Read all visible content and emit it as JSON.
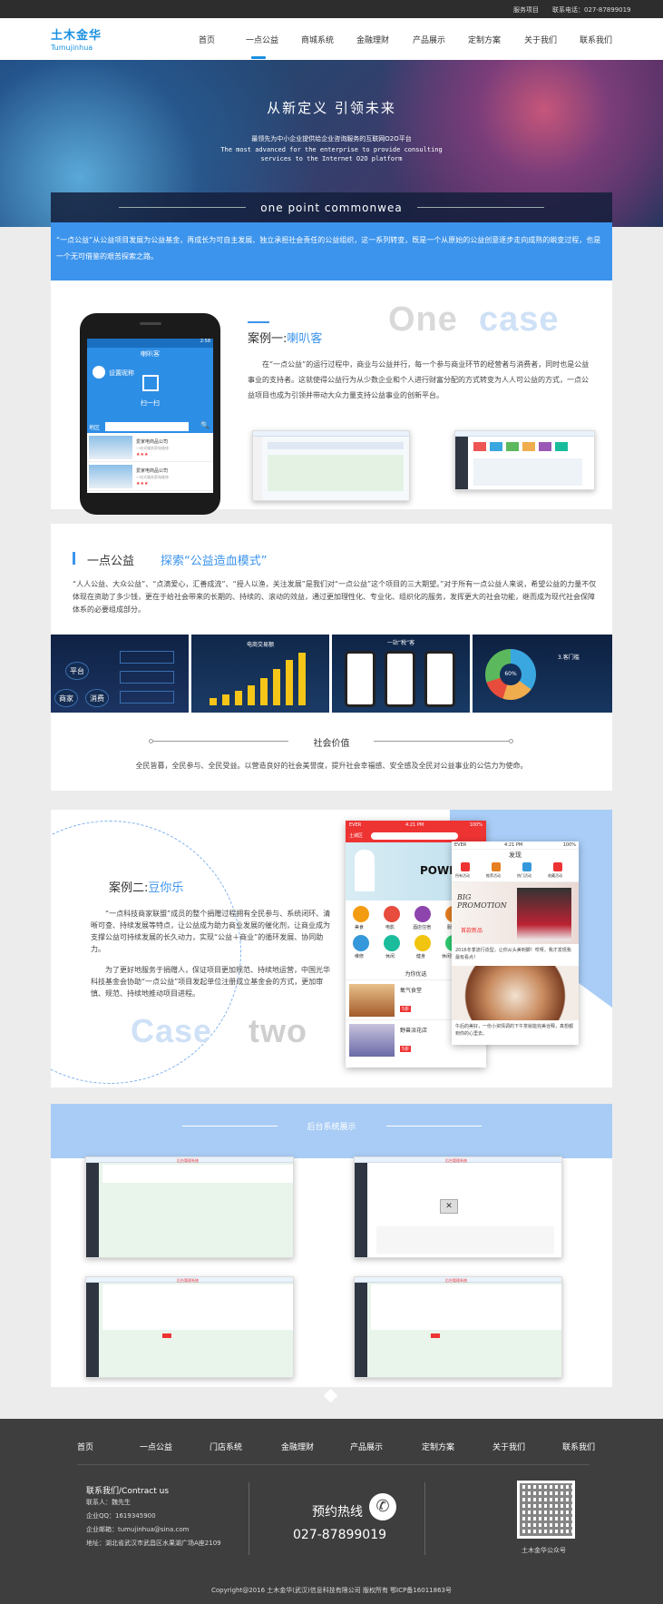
{
  "topbar": {
    "service": "服务项目",
    "contact": "联系电话：027-87899019"
  },
  "brand": {
    "cn": "土木金华",
    "en": "Tumujinhua",
    "color": "#1a8fe0"
  },
  "nav": [
    {
      "label": "首页"
    },
    {
      "label": "一点公益"
    },
    {
      "label": "商城系统"
    },
    {
      "label": "金融理财"
    },
    {
      "label": "产品展示"
    },
    {
      "label": "定制方案"
    },
    {
      "label": "关于我们"
    },
    {
      "label": "联系我们"
    }
  ],
  "hero": {
    "title": "从新定义    引领未来",
    "sub1": "最领先为中小企业提供给企业咨询服务的互联网O2O平台",
    "sub2_line1": "The most advanced for the enterprise to provide consulting",
    "sub2_line2": "services to the Internet O2O platform"
  },
  "band": {
    "title": "one point commonwea"
  },
  "intro": "“一点公益”从公益项目发展为公益基金，再成长为可自主发展、独立承担社会责任的公益组织，这一系列转变，既是一个从原始的公益创意逐步走向成熟的蜕变过程，也是一个无可借鉴的艰苦探索之路。",
  "case1": {
    "label": "案例一:",
    "name": "喇叭客",
    "wm1": "One",
    "wm2": "case",
    "text": "在“一点公益”的运行过程中，商业与公益并行，每一个参与商业环节的经营者与消费者，同时也是公益事业的支持者。这就使得公益行为从少数企业和个人进行财富分配的方式转变为人人可公益的方式，一点公益项目也成为引领并带动大众力量支持公益事业的创新平台。",
    "phone": {
      "status": "2:58",
      "title": "喇叭客",
      "login": "设置昵称",
      "scan": "扫一扫",
      "region": "地区",
      "items": [
        {
          "name": "爱家电商品公司",
          "desc": "一站式服务家电维修"
        },
        {
          "name": "爱家电商品公司",
          "desc": "一站式服务家电维修"
        }
      ]
    }
  },
  "gongyi": {
    "title": "一点公益",
    "slogan": "探索“公益造血模式”",
    "text": "“人人公益、大众公益”、“点滴爱心，汇善成流”、“授人以渔，关注发展”是我们对“一点公益”这个项目的三大期望。”对于所有一点公益人来说，希望公益的力量不仅体现在资助了多少钱，更在于给社会带来的长期的、持续的、滚动的效益，通过更加理性化、专业化、组织化的服务，发挥更大的社会功能，继而成为现代社会保障体系的必要组成部分。",
    "tiles": [
      {
        "a": "平台",
        "b": "商家",
        "c": "消费"
      },
      {
        "title": "电商交易额"
      },
      {
        "title": "一站“税”客"
      },
      {
        "title": "3.客门槛",
        "pie": "60%"
      }
    ],
    "value_title": "社会价值",
    "value_text": "全民皆募，全民参与、全民受益。以营造良好的社会美誉度，提升社会幸福感、安全感及全民对公益事业的公信力为使命。"
  },
  "case2": {
    "label": "案例二:",
    "name": "豆你乐",
    "wm1": "Case",
    "wm2": "two",
    "p1": "“一点科技商家联盟”成员的整个捐赠过程拥有全民参与、系统闭环、清晰可查、持续发展等特点，让公益成为助力商业发展的催化剂，让商业成为支撑公益可持续发展的长久动力，实现“公益＋商业”的循环发展、协同助力。",
    "p2": "为了更好地服务于捐赠人，保证项目更加规范、持续地运营，中国光华科技基金会协助“一点公益”项目发起单位注册成立基金会的方式，更加审慎、规范、持续地推动项目进程。",
    "app1": {
      "time": "4:21 PM",
      "carrier": "EVER",
      "battery": "100%",
      "city": "土城区",
      "cats": [
        "美食",
        "电影",
        "酒店住宿",
        "服饰",
        "维修",
        "休闲",
        "健身",
        "休闲娱乐"
      ],
      "promo_title": "POWER",
      "list_title": "为你优选",
      "shops": [
        {
          "name": "氧气食堂",
          "tag": "5折"
        },
        {
          "name": "野兽派花店",
          "tag": "5折"
        }
      ]
    },
    "app2": {
      "time": "4:21 PM",
      "carrier": "EVER",
      "battery": "100%",
      "title": "发现",
      "tabs": [
        "所有活动",
        "推荐活动",
        "热门活动",
        "收藏活动"
      ],
      "promo": "BIG PROMOTION",
      "new": "首款新品",
      "c1": "2016冬季流行造型，让你从头美到脚！哎呀，我才发现我最有看点！",
      "c2": "午后的美好，一份小资情调的下午茶就能完美诠释，真想都到你的心里去。"
    }
  },
  "admin": {
    "title": "后台系统展示",
    "shots": [
      {
        "title": "后台管理系统"
      },
      {
        "title": "后台管理系统"
      },
      {
        "title": "后台管理系统"
      },
      {
        "title": "后台管理系统"
      }
    ]
  },
  "footer": {
    "nav": [
      "首页",
      "一点公益",
      "门店系统",
      "金融理财",
      "产品展示",
      "定制方案",
      "关于我们",
      "联系我们"
    ],
    "contact_title": "联系我们/Contract us",
    "person": "联系人：魏先生",
    "qq": "企业QQ：1619345900",
    "email": "企业邮箱：tumujinhua@sina.com",
    "address": "地址：湖北省武汉市武昌区水果湖广场A座2109",
    "hotline_label": "预约热线",
    "hotline": "027-87899019",
    "qr_caption": "土木金华公众号",
    "copyright": "Copyright@2016 土木金华(武汉)信息科技有限公司 版权所有 鄂ICP备16011863号"
  }
}
